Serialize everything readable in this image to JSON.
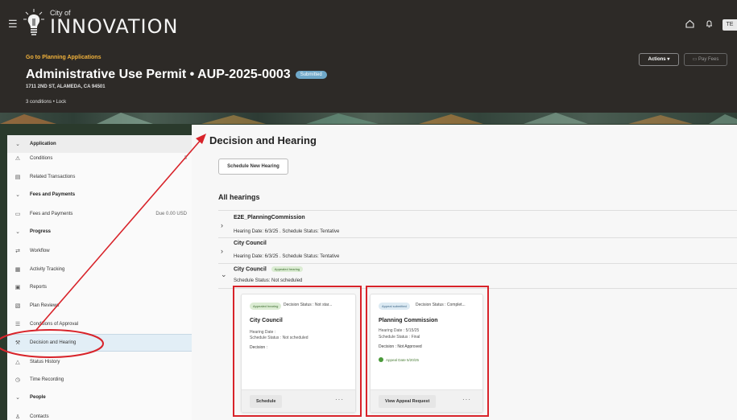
{
  "header": {
    "logo_city": "City of",
    "logo_name": "INNOVATION",
    "avatar": "TE",
    "goto_link": "Go to Planning Applications",
    "title": "Administrative Use Permit • AUP-2025-0003",
    "status": "Submitted",
    "address": "1711 2ND ST, ALAMEDA, CA 94501",
    "conditions_lock": "3 conditions • Lock",
    "actions_label": "Actions",
    "pay_fees_label": "Pay Fees"
  },
  "sidebar": {
    "items": [
      {
        "label": "Application",
        "icon": "chevron-down-icon",
        "meta": ""
      },
      {
        "label": "Conditions",
        "icon": "warning-icon",
        "meta": "3"
      },
      {
        "label": "Related Transactions",
        "icon": "document-icon",
        "meta": ""
      },
      {
        "label": "Fees and Payments",
        "icon": "chevron-down-icon",
        "meta": ""
      },
      {
        "label": "Fees and Payments",
        "icon": "card-icon",
        "meta": "Due 0.00 USD"
      },
      {
        "label": "Progress",
        "icon": "chevron-down-icon",
        "meta": ""
      },
      {
        "label": "Workflow",
        "icon": "workflow-icon",
        "meta": ""
      },
      {
        "label": "Activity Tracking",
        "icon": "activity-icon",
        "meta": ""
      },
      {
        "label": "Reports",
        "icon": "report-icon",
        "meta": ""
      },
      {
        "label": "Plan Reviews",
        "icon": "plan-review-icon",
        "meta": ""
      },
      {
        "label": "Conditions of Approval",
        "icon": "list-icon",
        "meta": ""
      },
      {
        "label": "Decision and Hearing",
        "icon": "gavel-icon",
        "meta": ""
      },
      {
        "label": "Status History",
        "icon": "history-icon",
        "meta": ""
      },
      {
        "label": "Time Recording",
        "icon": "clock-icon",
        "meta": ""
      },
      {
        "label": "People",
        "icon": "chevron-down-icon",
        "meta": ""
      },
      {
        "label": "Contacts",
        "icon": "person-icon",
        "meta": ""
      }
    ]
  },
  "main": {
    "title": "Decision and Hearing",
    "new_hearing_label": "Schedule New Hearing",
    "all_hearings_label": "All hearings",
    "hearings": [
      {
        "name": "E2E_PlanningCommission",
        "info": "Hearing Date: 6/3/25 . Schedule Status: Tentative",
        "pill": ""
      },
      {
        "name": "City Council",
        "info": "Hearing Date: 6/3/25 . Schedule Status: Tentative",
        "pill": ""
      },
      {
        "name": "City Council",
        "info": "Schedule Status: Not scheduled",
        "pill": "Appealed hearing"
      }
    ],
    "cards": [
      {
        "badge": "Appealed hearing",
        "decision_status": "Decision Status : Not star...",
        "title": "City Council",
        "line1": "Hearing Date :",
        "line2": "Schedule Status : Not scheduled",
        "decision": "Decision :",
        "appeal_date": "",
        "button": "Schedule",
        "more": "···"
      },
      {
        "badge": "Appeal submitted",
        "decision_status": "Decision Status : Complet...",
        "title": "Planning Commission",
        "line1": "Hearing Date : 5/15/25",
        "line2": "Schedule Status : Final",
        "decision": "Decision : Not Approved",
        "appeal_date": "Appeal Date 5/20/25",
        "button": "View Appeal Request",
        "more": "···"
      }
    ]
  },
  "colors": {
    "header_bg": "#2d2a27",
    "goto_link": "#f0b13b",
    "status_pill": "#6fa8c9",
    "highlight_red": "#d8232a",
    "selected_bg": "#e2eef6"
  }
}
